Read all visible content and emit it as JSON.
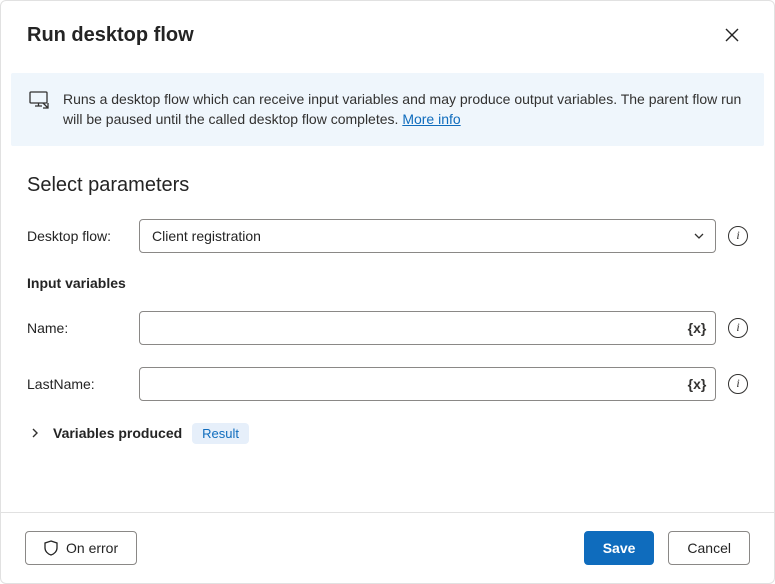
{
  "header": {
    "title": "Run desktop flow"
  },
  "banner": {
    "text": "Runs a desktop flow which can receive input variables and may produce output variables. The parent flow run will be paused until the called desktop flow completes. ",
    "more_info": "More info"
  },
  "section_title": "Select parameters",
  "labels": {
    "desktop_flow": "Desktop flow:",
    "input_variables": "Input variables",
    "name": "Name:",
    "lastname": "LastName:",
    "variables_produced": "Variables produced"
  },
  "fields": {
    "desktop_flow_value": "Client registration",
    "name_value": "",
    "lastname_value": ""
  },
  "output_chip": "Result",
  "footer": {
    "on_error": "On error",
    "save": "Save",
    "cancel": "Cancel"
  }
}
